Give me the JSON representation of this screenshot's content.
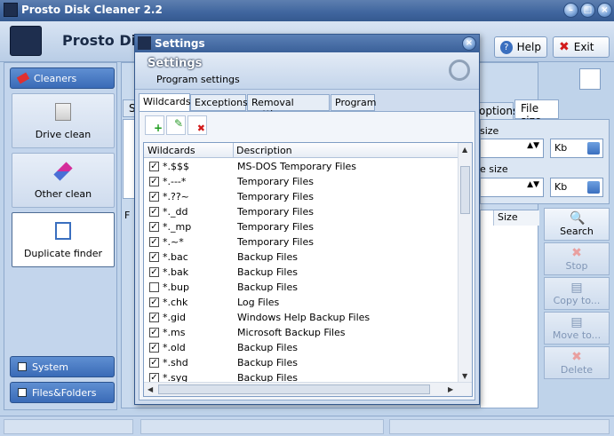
{
  "app": {
    "title": "Prosto Disk Cleaner 2.2",
    "name": "Prosto Disk"
  },
  "header": {
    "help_label": "Help",
    "exit_label": "Exit"
  },
  "sidebar": {
    "cleaners_label": "Cleaners",
    "items": [
      {
        "label": "Drive clean",
        "icon": "drive-icon"
      },
      {
        "label": "Other clean",
        "icon": "eraser-icon"
      },
      {
        "label": "Duplicate finder",
        "icon": "duplicate-icon"
      }
    ],
    "system_label": "System",
    "files_label": "Files&Folders"
  },
  "background": {
    "tab_options": "options",
    "tab_filesize": "File size",
    "size_label_1": "size",
    "size_label_2": "e size",
    "unit_1": "Kb",
    "unit_2": "Kb",
    "col_size": "Size",
    "col_f": "F",
    "tab_se": "Se",
    "actions": {
      "search": "Search",
      "stop": "Stop",
      "copy": "Copy to...",
      "move": "Move to...",
      "delete": "Delete"
    }
  },
  "dialog": {
    "title": "Settings",
    "heading": "Settings",
    "subheading": "Program settings",
    "tabs": [
      "Wildcards",
      "Exceptions",
      "Removal settings",
      "Program"
    ],
    "columns": [
      "Wildcards",
      "Description"
    ],
    "rows": [
      {
        "wildcard": "*.$$$",
        "description": "MS-DOS Temporary Files",
        "checked": true
      },
      {
        "wildcard": "*.---*",
        "description": "Temporary Files",
        "checked": true
      },
      {
        "wildcard": "*.??~",
        "description": "Temporary Files",
        "checked": true
      },
      {
        "wildcard": "*._dd",
        "description": "Temporary Files",
        "checked": true
      },
      {
        "wildcard": "*._mp",
        "description": "Temporary Files",
        "checked": true
      },
      {
        "wildcard": "*.~*",
        "description": "Temporary Files",
        "checked": true
      },
      {
        "wildcard": "*.bac",
        "description": "Backup Files",
        "checked": true
      },
      {
        "wildcard": "*.bak",
        "description": "Backup Files",
        "checked": true
      },
      {
        "wildcard": "*.bup",
        "description": "Backup Files",
        "checked": false
      },
      {
        "wildcard": "*.chk",
        "description": "Log Files",
        "checked": true
      },
      {
        "wildcard": "*.gid",
        "description": "Windows Help Backup Files",
        "checked": true
      },
      {
        "wildcard": "*.ms",
        "description": "Microsoft Backup Files",
        "checked": true
      },
      {
        "wildcard": "*.old",
        "description": "Backup Files",
        "checked": true
      },
      {
        "wildcard": "*.shd",
        "description": "Backup Files",
        "checked": true
      },
      {
        "wildcard": "*.syg",
        "description": "Backup Files",
        "checked": true
      }
    ]
  }
}
